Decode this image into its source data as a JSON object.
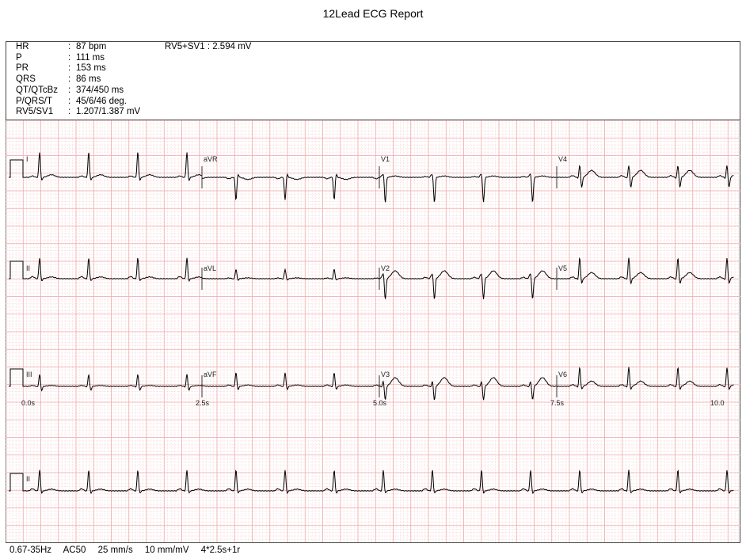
{
  "report": {
    "title": "12Lead ECG Report"
  },
  "measurements": [
    {
      "label": "HR",
      "value": "87 bpm"
    },
    {
      "label": "P",
      "value": "111 ms"
    },
    {
      "label": "PR",
      "value": "153 ms"
    },
    {
      "label": "QRS",
      "value": "86 ms"
    },
    {
      "label": "QT/QTcBz",
      "value": "374/450 ms"
    },
    {
      "label": "P/QRS/T",
      "value": "45/6/46 deg."
    },
    {
      "label": "RV5/SV1",
      "value": "1.207/1.387 mV"
    }
  ],
  "rv_sum": {
    "label": "RV5+SV1",
    "value": "2.594 mV"
  },
  "leads": [
    [
      "I",
      "aVR",
      "V1",
      "V4"
    ],
    [
      "II",
      "aVL",
      "V2",
      "V5"
    ],
    [
      "III",
      "aVF",
      "V3",
      "V6"
    ],
    [
      "II"
    ]
  ],
  "time_labels": [
    "0.0s",
    "2.5s",
    "5.0s",
    "7.5s",
    "10.0"
  ],
  "footer": {
    "filter": "0.67-35Hz",
    "ac": "AC50",
    "speed": "25 mm/s",
    "gain": "10 mm/mV",
    "layout": "4*2.5s+1r"
  },
  "colors": {
    "grid_major": "#f2a8a8",
    "grid_minor": "#f7cccc",
    "trace": "#000000"
  }
}
